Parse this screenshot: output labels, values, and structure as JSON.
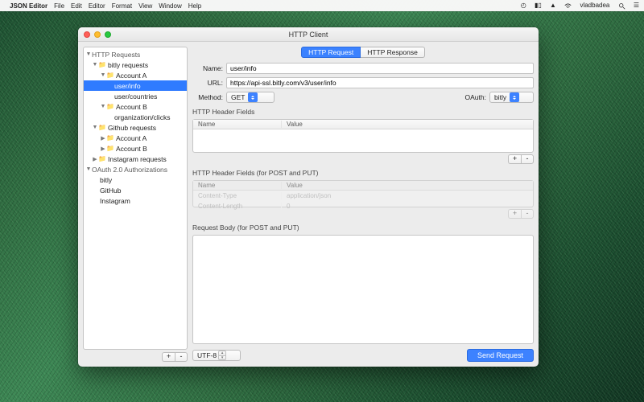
{
  "menubar": {
    "app": "JSON Editor",
    "items": [
      "File",
      "Edit",
      "Editor",
      "Format",
      "View",
      "Window",
      "Help"
    ],
    "user": "vladbadea"
  },
  "window": {
    "title": "HTTP Client"
  },
  "sidebar": {
    "groups": [
      {
        "label": "HTTP Requests",
        "children": [
          {
            "label": "bitly requests",
            "children": [
              {
                "label": "Account A",
                "children": [
                  {
                    "label": "user/info",
                    "selected": true
                  },
                  {
                    "label": "user/countries"
                  }
                ]
              },
              {
                "label": "Account B",
                "children": [
                  {
                    "label": "organization/clicks"
                  }
                ]
              }
            ]
          },
          {
            "label": "Github requests",
            "children": [
              {
                "label": "Account A",
                "collapsed": true
              },
              {
                "label": "Account B",
                "collapsed": true
              }
            ]
          },
          {
            "label": "Instagram requests",
            "collapsed": true
          }
        ]
      },
      {
        "label": "OAuth 2.0 Authorizations",
        "children": [
          {
            "label": "bitly"
          },
          {
            "label": "GitHub"
          },
          {
            "label": "Instagram"
          }
        ]
      }
    ],
    "add": "+",
    "remove": "-"
  },
  "tabs": {
    "request": "HTTP Request",
    "response": "HTTP Response"
  },
  "form": {
    "name_label": "Name:",
    "name_value": "user/info",
    "url_label": "URL:",
    "url_value": "https://api-ssl.bitly.com/v3/user/info",
    "method_label": "Method:",
    "method_value": "GET",
    "oauth_label": "OAuth:",
    "oauth_value": "bitly"
  },
  "headers": {
    "title": "HTTP Header Fields",
    "name_col": "Name",
    "value_col": "Value"
  },
  "post_headers": {
    "title": "HTTP Header Fields (for POST and PUT)",
    "name_col": "Name",
    "value_col": "Value",
    "rows": [
      {
        "name": "Content-Type",
        "value": "application/json"
      },
      {
        "name": "Content-Length",
        "value": "0"
      }
    ]
  },
  "body": {
    "title": "Request Body (for POST and PUT)"
  },
  "footer": {
    "encoding": "UTF-8",
    "send": "Send Request"
  },
  "buttons": {
    "plus": "+",
    "minus": "-"
  }
}
